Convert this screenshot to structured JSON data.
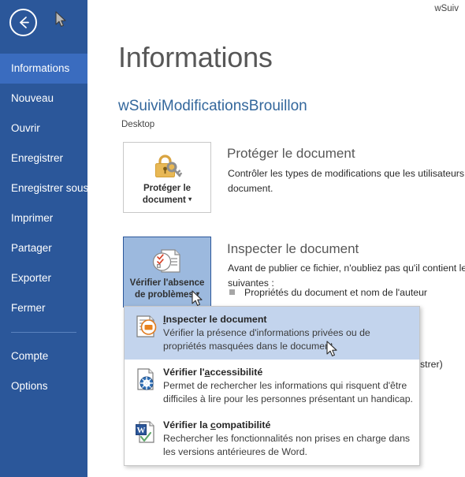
{
  "window": {
    "title_truncated": "wSuiv"
  },
  "sidebar": {
    "back_label": "Retour",
    "items": [
      {
        "label": "Informations",
        "selected": true
      },
      {
        "label": "Nouveau",
        "selected": false
      },
      {
        "label": "Ouvrir",
        "selected": false
      },
      {
        "label": "Enregistrer",
        "selected": false
      },
      {
        "label": "Enregistrer sous",
        "selected": false
      },
      {
        "label": "Imprimer",
        "selected": false
      },
      {
        "label": "Partager",
        "selected": false
      },
      {
        "label": "Exporter",
        "selected": false
      },
      {
        "label": "Fermer",
        "selected": false
      }
    ],
    "items_bottom": [
      {
        "label": "Compte"
      },
      {
        "label": "Options"
      }
    ]
  },
  "main": {
    "page_title": "Informations",
    "document_name": "wSuiviModificationsBrouillon",
    "document_path": "Desktop",
    "protect": {
      "tile_label_line1": "Protéger le",
      "tile_label_line2": "document",
      "tile_caret": "▾",
      "heading": "Protéger le document",
      "body_line1": "Contrôler les types de modifications que les utilisateurs pe",
      "body_line2": "document."
    },
    "inspect": {
      "tile_label_line1": "Vérifier l'absence",
      "tile_label_line2": "de problèmes",
      "tile_caret": "▾",
      "heading": "Inspecter le document",
      "body_line1": "Avant de publier ce fichier, n'oubliez pas qu'il contient les",
      "body_line2": "suivantes :",
      "bullet_1": "Propriétés du document et nom de l'auteur",
      "clipped_text": "strer)"
    }
  },
  "menu": {
    "items": [
      {
        "icon": "inspect-document-icon",
        "title_pre": "",
        "title_accel": "I",
        "title_post": "nspecter le document",
        "desc_line1": "Vérifier la présence d'informations privées ou de",
        "desc_line2": "propriétés masquées dans le document.",
        "highlighted": true
      },
      {
        "icon": "accessibility-icon",
        "title_pre": "Vérifier l'",
        "title_accel": "a",
        "title_post": "ccessibilité",
        "desc_line1": "Permet de rechercher les informations qui risquent d'être",
        "desc_line2": "difficiles à lire pour les personnes présentant un handicap.",
        "highlighted": false
      },
      {
        "icon": "word-compatibility-icon",
        "title_pre": "Vérifier la ",
        "title_accel": "c",
        "title_post": "ompatibilité",
        "desc_line1": "Rechercher les fonctionnalités non prises en charge dans",
        "desc_line2": "les versions antérieures de Word.",
        "highlighted": false
      }
    ]
  },
  "colors": {
    "sidebar_bg": "#2b579a",
    "sidebar_selected": "#3a6cbf",
    "accent_blue": "#33679c",
    "tile_active_bg": "#9cb9de",
    "menu_highlight": "#c3d4ed"
  }
}
